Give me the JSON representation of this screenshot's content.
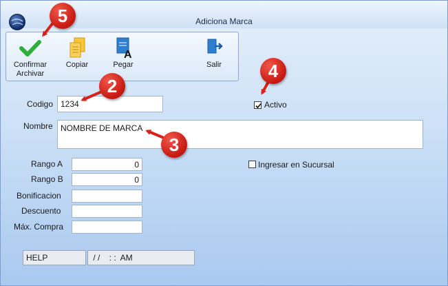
{
  "window": {
    "title": "Adiciona Marca"
  },
  "toolbar": {
    "confirm_label_1": "Confirmar",
    "confirm_label_2": "Archivar",
    "copy_label": "Copiar",
    "paste_label": "Pegar",
    "exit_label": "Salir"
  },
  "form": {
    "codigo_label": "Codigo",
    "codigo_value": "1234",
    "nombre_label": "Nombre",
    "nombre_value": "NOMBRE DE MARCA",
    "activo_label": "Activo",
    "activo_checked": true,
    "rango_a_label": "Rango A",
    "rango_a_value": "0",
    "rango_b_label": "Rango B",
    "rango_b_value": "0",
    "bonificacion_label": "Bonificacion",
    "bonificacion_value": "",
    "descuento_label": "Descuento",
    "descuento_value": "",
    "max_compra_label": "Máx. Compra",
    "max_compra_value": "",
    "sucursal_label": "Ingresar en Sucursal",
    "sucursal_checked": false
  },
  "status": {
    "help": "HELP",
    "datetime": " / /    : :  AM"
  },
  "callouts": [
    "2",
    "3",
    "4",
    "5"
  ],
  "colors": {
    "callout": "#d8221a",
    "accent": "#2f7fd1",
    "confirm": "#2fae3c"
  }
}
